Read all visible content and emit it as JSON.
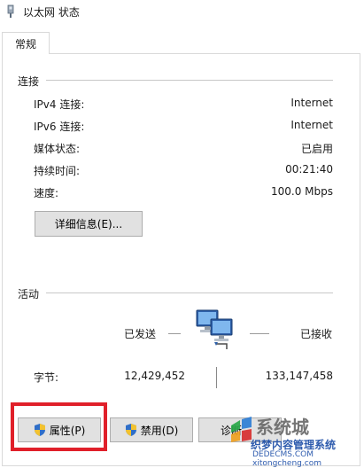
{
  "window": {
    "title": "以太网 状态"
  },
  "tabs": [
    {
      "label": "常规"
    }
  ],
  "connection": {
    "title": "连接",
    "rows": [
      {
        "label": "IPv4 连接:",
        "value": "Internet"
      },
      {
        "label": "IPv6 连接:",
        "value": "Internet"
      },
      {
        "label": "媒体状态:",
        "value": "已启用"
      },
      {
        "label": "持续时间:",
        "value": "00:21:40"
      },
      {
        "label": "速度:",
        "value": "100.0 Mbps"
      }
    ],
    "details_button": "详细信息(E)..."
  },
  "activity": {
    "title": "活动",
    "sent_label": "已发送",
    "received_label": "已接收",
    "bytes_label": "字节:",
    "bytes_sent": "12,429,452",
    "bytes_received": "133,147,458"
  },
  "buttons": {
    "properties": "属性(P)",
    "disable": "禁用(D)",
    "diagnose": "诊断"
  },
  "watermark": {
    "big": "系统城",
    "mid": "织梦内容管理系统",
    "small": "DEDECMS.COM xitongcheng.com"
  },
  "colors": {
    "highlight": "#e0202a",
    "button_bg": "#e1e1e1",
    "divider": "#c8c8c8"
  }
}
